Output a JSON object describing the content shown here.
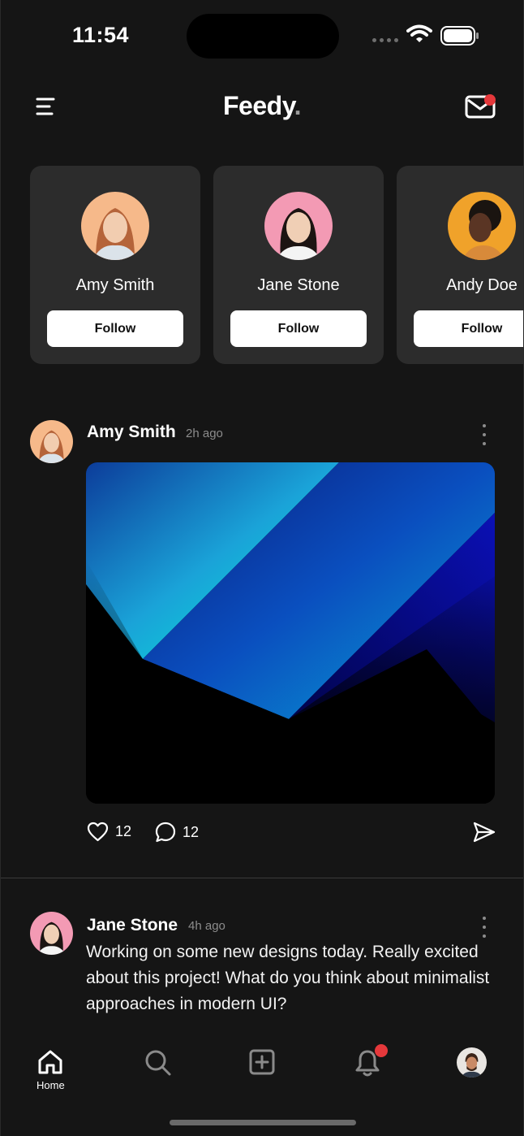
{
  "status_bar": {
    "time": "11:54"
  },
  "header": {
    "title": "Feedy",
    "title_dot": "."
  },
  "suggestions": [
    {
      "name": "Amy Smith",
      "button": "Follow",
      "avatar_bg": "#f6b98a"
    },
    {
      "name": "Jane Stone",
      "button": "Follow",
      "avatar_bg": "#f39ab4"
    },
    {
      "name": "Andy Doe",
      "button": "Follow",
      "avatar_bg": "#f0a22a"
    }
  ],
  "posts": [
    {
      "author": "Amy Smith",
      "time": "2h ago",
      "likes": "12",
      "comments": "12"
    },
    {
      "author": "Jane Stone",
      "time": "4h ago",
      "text": "Working on some new designs today. Really excited about this project! What do you think about minimalist approaches in modern UI?"
    }
  ],
  "tabbar": {
    "home_label": "Home"
  },
  "colors": {
    "accent_red": "#e5383b",
    "background": "#151515",
    "card": "#2c2c2c"
  },
  "icons": [
    "menu-icon",
    "mail-icon",
    "more-icon",
    "heart-icon",
    "comment-icon",
    "send-icon",
    "home-icon",
    "search-icon",
    "plus-square-icon",
    "bell-icon"
  ]
}
